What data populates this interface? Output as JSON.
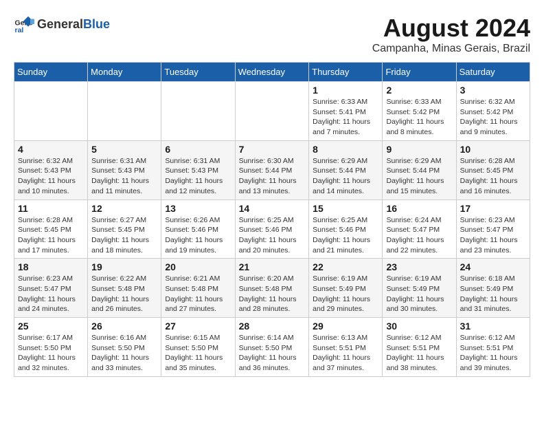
{
  "logo": {
    "general": "General",
    "blue": "Blue"
  },
  "title": {
    "month_year": "August 2024",
    "location": "Campanha, Minas Gerais, Brazil"
  },
  "weekdays": [
    "Sunday",
    "Monday",
    "Tuesday",
    "Wednesday",
    "Thursday",
    "Friday",
    "Saturday"
  ],
  "weeks": [
    [
      {
        "day": "",
        "info": ""
      },
      {
        "day": "",
        "info": ""
      },
      {
        "day": "",
        "info": ""
      },
      {
        "day": "",
        "info": ""
      },
      {
        "day": "1",
        "info": "Sunrise: 6:33 AM\nSunset: 5:41 PM\nDaylight: 11 hours\nand 7 minutes."
      },
      {
        "day": "2",
        "info": "Sunrise: 6:33 AM\nSunset: 5:42 PM\nDaylight: 11 hours\nand 8 minutes."
      },
      {
        "day": "3",
        "info": "Sunrise: 6:32 AM\nSunset: 5:42 PM\nDaylight: 11 hours\nand 9 minutes."
      }
    ],
    [
      {
        "day": "4",
        "info": "Sunrise: 6:32 AM\nSunset: 5:43 PM\nDaylight: 11 hours\nand 10 minutes."
      },
      {
        "day": "5",
        "info": "Sunrise: 6:31 AM\nSunset: 5:43 PM\nDaylight: 11 hours\nand 11 minutes."
      },
      {
        "day": "6",
        "info": "Sunrise: 6:31 AM\nSunset: 5:43 PM\nDaylight: 11 hours\nand 12 minutes."
      },
      {
        "day": "7",
        "info": "Sunrise: 6:30 AM\nSunset: 5:44 PM\nDaylight: 11 hours\nand 13 minutes."
      },
      {
        "day": "8",
        "info": "Sunrise: 6:29 AM\nSunset: 5:44 PM\nDaylight: 11 hours\nand 14 minutes."
      },
      {
        "day": "9",
        "info": "Sunrise: 6:29 AM\nSunset: 5:44 PM\nDaylight: 11 hours\nand 15 minutes."
      },
      {
        "day": "10",
        "info": "Sunrise: 6:28 AM\nSunset: 5:45 PM\nDaylight: 11 hours\nand 16 minutes."
      }
    ],
    [
      {
        "day": "11",
        "info": "Sunrise: 6:28 AM\nSunset: 5:45 PM\nDaylight: 11 hours\nand 17 minutes."
      },
      {
        "day": "12",
        "info": "Sunrise: 6:27 AM\nSunset: 5:45 PM\nDaylight: 11 hours\nand 18 minutes."
      },
      {
        "day": "13",
        "info": "Sunrise: 6:26 AM\nSunset: 5:46 PM\nDaylight: 11 hours\nand 19 minutes."
      },
      {
        "day": "14",
        "info": "Sunrise: 6:25 AM\nSunset: 5:46 PM\nDaylight: 11 hours\nand 20 minutes."
      },
      {
        "day": "15",
        "info": "Sunrise: 6:25 AM\nSunset: 5:46 PM\nDaylight: 11 hours\nand 21 minutes."
      },
      {
        "day": "16",
        "info": "Sunrise: 6:24 AM\nSunset: 5:47 PM\nDaylight: 11 hours\nand 22 minutes."
      },
      {
        "day": "17",
        "info": "Sunrise: 6:23 AM\nSunset: 5:47 PM\nDaylight: 11 hours\nand 23 minutes."
      }
    ],
    [
      {
        "day": "18",
        "info": "Sunrise: 6:23 AM\nSunset: 5:47 PM\nDaylight: 11 hours\nand 24 minutes."
      },
      {
        "day": "19",
        "info": "Sunrise: 6:22 AM\nSunset: 5:48 PM\nDaylight: 11 hours\nand 26 minutes."
      },
      {
        "day": "20",
        "info": "Sunrise: 6:21 AM\nSunset: 5:48 PM\nDaylight: 11 hours\nand 27 minutes."
      },
      {
        "day": "21",
        "info": "Sunrise: 6:20 AM\nSunset: 5:48 PM\nDaylight: 11 hours\nand 28 minutes."
      },
      {
        "day": "22",
        "info": "Sunrise: 6:19 AM\nSunset: 5:49 PM\nDaylight: 11 hours\nand 29 minutes."
      },
      {
        "day": "23",
        "info": "Sunrise: 6:19 AM\nSunset: 5:49 PM\nDaylight: 11 hours\nand 30 minutes."
      },
      {
        "day": "24",
        "info": "Sunrise: 6:18 AM\nSunset: 5:49 PM\nDaylight: 11 hours\nand 31 minutes."
      }
    ],
    [
      {
        "day": "25",
        "info": "Sunrise: 6:17 AM\nSunset: 5:50 PM\nDaylight: 11 hours\nand 32 minutes."
      },
      {
        "day": "26",
        "info": "Sunrise: 6:16 AM\nSunset: 5:50 PM\nDaylight: 11 hours\nand 33 minutes."
      },
      {
        "day": "27",
        "info": "Sunrise: 6:15 AM\nSunset: 5:50 PM\nDaylight: 11 hours\nand 35 minutes."
      },
      {
        "day": "28",
        "info": "Sunrise: 6:14 AM\nSunset: 5:50 PM\nDaylight: 11 hours\nand 36 minutes."
      },
      {
        "day": "29",
        "info": "Sunrise: 6:13 AM\nSunset: 5:51 PM\nDaylight: 11 hours\nand 37 minutes."
      },
      {
        "day": "30",
        "info": "Sunrise: 6:12 AM\nSunset: 5:51 PM\nDaylight: 11 hours\nand 38 minutes."
      },
      {
        "day": "31",
        "info": "Sunrise: 6:12 AM\nSunset: 5:51 PM\nDaylight: 11 hours\nand 39 minutes."
      }
    ]
  ]
}
